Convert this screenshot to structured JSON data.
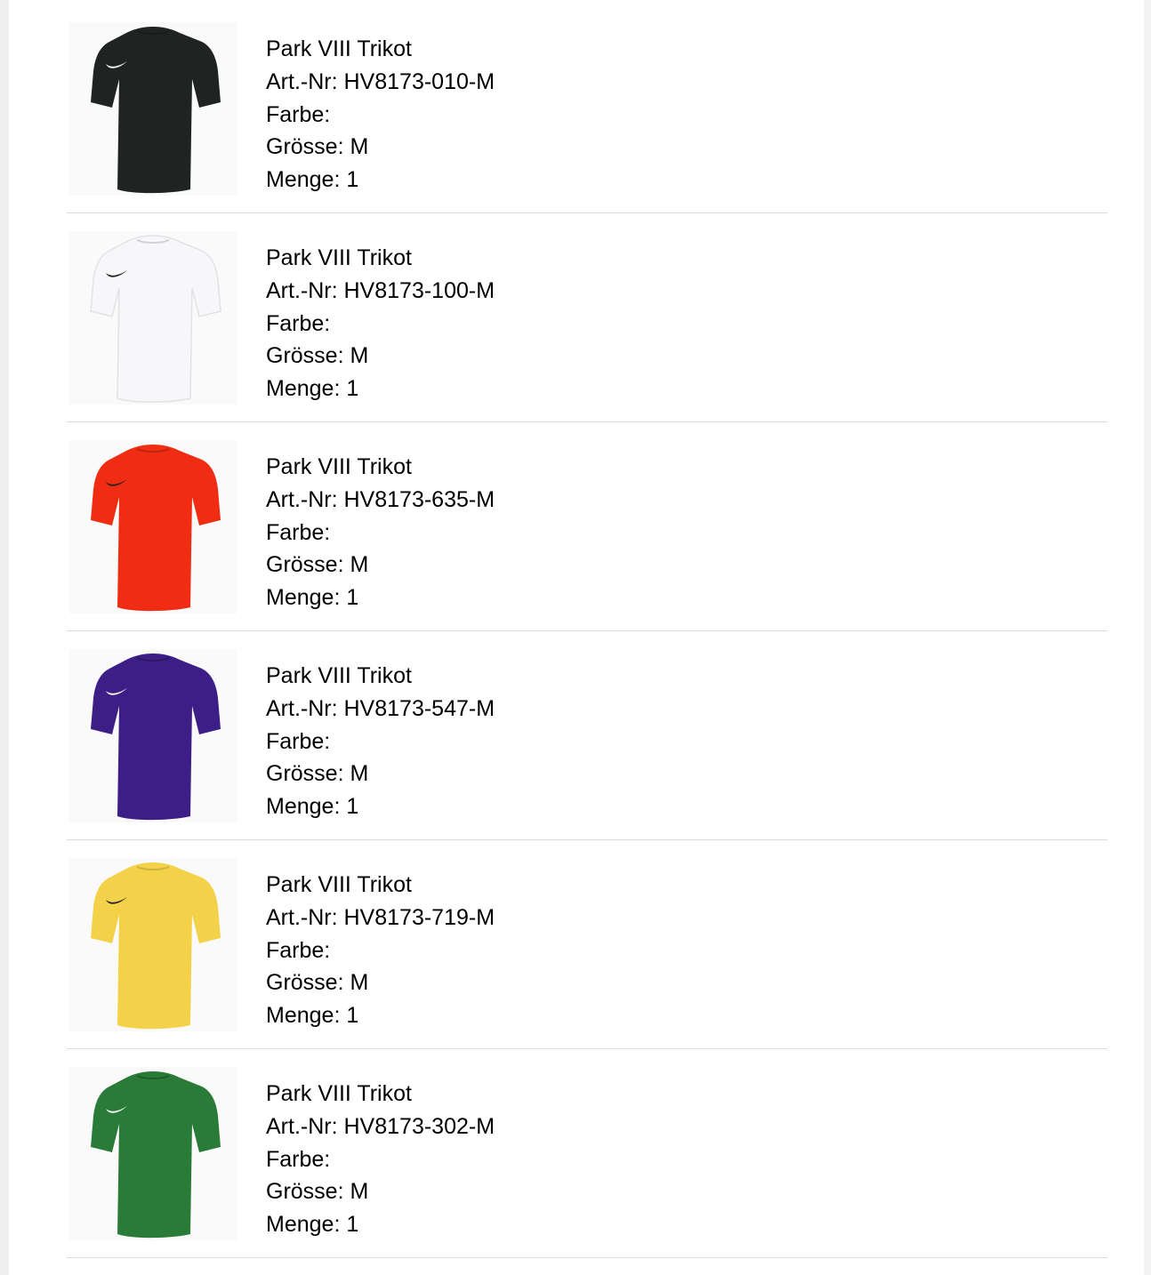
{
  "items": [
    {
      "name": "Park VIII Trikot",
      "art_label": "Art.-Nr:",
      "art_nr": "HV8173-010-M",
      "color_label": "Farbe:",
      "color": "",
      "size_label": "Grösse:",
      "size": "M",
      "qty_label": "Menge:",
      "qty": "1",
      "shirt_color": "#1f2321",
      "logo_color": "#ffffff"
    },
    {
      "name": "Park VIII Trikot",
      "art_label": "Art.-Nr:",
      "art_nr": "HV8173-100-M",
      "color_label": "Farbe:",
      "color": "",
      "size_label": "Grösse:",
      "size": "M",
      "qty_label": "Menge:",
      "qty": "1",
      "shirt_color": "#f7f7f9",
      "logo_color": "#222222"
    },
    {
      "name": "Park VIII Trikot",
      "art_label": "Art.-Nr:",
      "art_nr": "HV8173-635-M",
      "color_label": "Farbe:",
      "color": "",
      "size_label": "Grösse:",
      "size": "M",
      "qty_label": "Menge:",
      "qty": "1",
      "shirt_color": "#f02d12",
      "logo_color": "#222222"
    },
    {
      "name": "Park VIII Trikot",
      "art_label": "Art.-Nr:",
      "art_nr": "HV8173-547-M",
      "color_label": "Farbe:",
      "color": "",
      "size_label": "Grösse:",
      "size": "M",
      "qty_label": "Menge:",
      "qty": "1",
      "shirt_color": "#3c1e86",
      "logo_color": "#ffffff"
    },
    {
      "name": "Park VIII Trikot",
      "art_label": "Art.-Nr:",
      "art_nr": "HV8173-719-M",
      "color_label": "Farbe:",
      "color": "",
      "size_label": "Grösse:",
      "size": "M",
      "qty_label": "Menge:",
      "qty": "1",
      "shirt_color": "#f3d24a",
      "logo_color": "#222222"
    },
    {
      "name": "Park VIII Trikot",
      "art_label": "Art.-Nr:",
      "art_nr": "HV8173-302-M",
      "color_label": "Farbe:",
      "color": "",
      "size_label": "Grösse:",
      "size": "M",
      "qty_label": "Menge:",
      "qty": "1",
      "shirt_color": "#2a7a38",
      "logo_color": "#ffffff"
    }
  ]
}
